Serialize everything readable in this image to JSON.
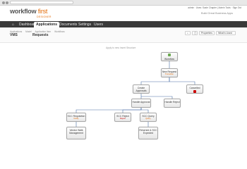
{
  "browser": {},
  "header": {
    "logo_main": "workflow",
    "logo_accent": "first",
    "logo_sub": "DESIGNER",
    "user_line": "admin · Uses: Scale Chapter | Admin Tools · Sign Out",
    "tagline": "Build Great Business Apps"
  },
  "nav": {
    "home_icon": "home-icon",
    "items": [
      "Dashboard",
      "Applications",
      "Documents",
      "Settings",
      "Users"
    ]
  },
  "subhead": {
    "crumb_labels": [
      "Applications",
      "Model",
      "Application Item",
      "Workflows"
    ],
    "app_name": "VMS",
    "item_name": "Requests",
    "tools": [
      "Properties",
      "What's Used"
    ]
  },
  "canvas": {
    "label": "Apply to new Insert Structure",
    "nodes": [
      {
        "label": "Workflow",
        "sub": "",
        "icon_color": "#6aa84f"
      },
      {
        "label": "New Request",
        "sub": "Transition",
        "icon_color": "#e46c0a"
      },
      {
        "label": "Create Approvals",
        "sub": "",
        "icon_color": "#4a86e8"
      },
      {
        "label": "Cancelled",
        "sub": "",
        "icon_color": "#cc0000"
      },
      {
        "label": "Handle Approval",
        "sub": "",
        "icon_color": "#4a86e8"
      },
      {
        "label": "Handle Reject",
        "sub": "",
        "icon_color": "#4a86e8"
      },
      {
        "label": "SCC Requisition",
        "sub": "Notify",
        "icon_color": "#e46c0a"
      },
      {
        "label": "SCC Reject",
        "sub": "Reject",
        "icon_color": "#cc0000"
      },
      {
        "label": "SCC Query",
        "sub": "Query",
        "icon_color": "#e46c0a"
      },
      {
        "label": "Vendor Walk Management",
        "sub": "",
        "icon_color": "#e46c0a"
      },
      {
        "label": "Returned & SCC Expected",
        "sub": "",
        "icon_color": "#e46c0a"
      }
    ]
  }
}
